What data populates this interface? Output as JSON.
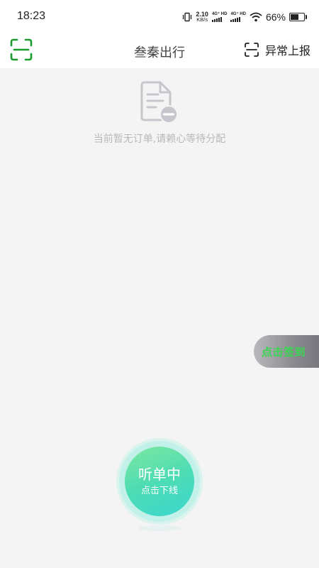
{
  "status_bar": {
    "time": "18:23",
    "net_speed_value": "2.10",
    "net_speed_unit": "KB/s",
    "sim1_label": "4G⁺ HD",
    "sim2_label": "4G⁺ HD",
    "battery_percent": "66%",
    "battery_level": 0.66,
    "icons": [
      "vibrate-icon",
      "signal-icon",
      "wifi-icon",
      "battery-icon"
    ]
  },
  "header": {
    "title": "叁秦出行",
    "report_label": "异常上报",
    "scan_icon_color": "#1a9b2c"
  },
  "empty_state": {
    "message": "当前暂无订单,请赖心等待分配",
    "icon": "no-order-document-icon"
  },
  "checkin": {
    "label": "点击签到",
    "label_color": "#39d651"
  },
  "listen_button": {
    "status": "听单中",
    "action": "点击下线"
  },
  "colors": {
    "background": "#f4f4f4",
    "brand_green": "#1a9b2c",
    "button_gradient": [
      "#7ee8a0",
      "#3bd6cf"
    ]
  }
}
